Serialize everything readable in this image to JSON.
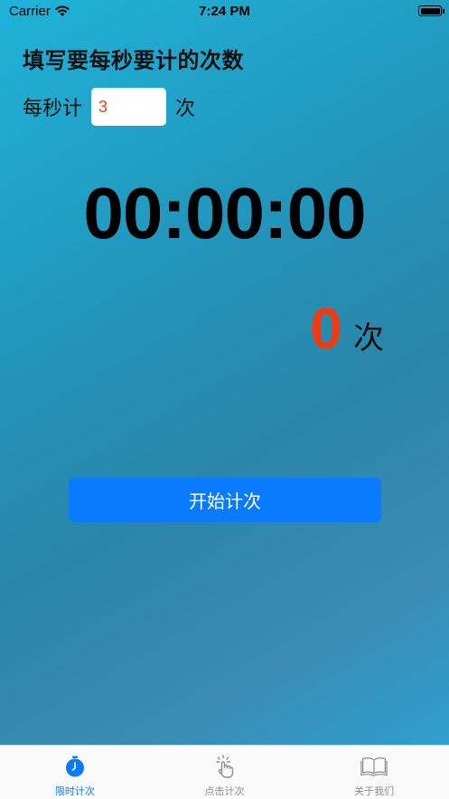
{
  "status_bar": {
    "carrier": "Carrier",
    "time": "7:24 PM"
  },
  "header": {
    "title": "填写要每秒要计的次数"
  },
  "rate": {
    "prefix": "每秒计",
    "value": "3",
    "suffix": "次"
  },
  "timer": {
    "display": "00:00:00"
  },
  "counter": {
    "value": "0",
    "unit": "次"
  },
  "start_button": {
    "label": "开始计次"
  },
  "tabs": [
    {
      "label": "限时计次",
      "icon": "stopwatch-icon",
      "active": true
    },
    {
      "label": "点击计次",
      "icon": "tap-icon",
      "active": false
    },
    {
      "label": "关于我们",
      "icon": "book-icon",
      "active": false
    }
  ],
  "colors": {
    "accent": "#0a7bff",
    "count": "#f03a12",
    "input_text": "#e8451e"
  }
}
